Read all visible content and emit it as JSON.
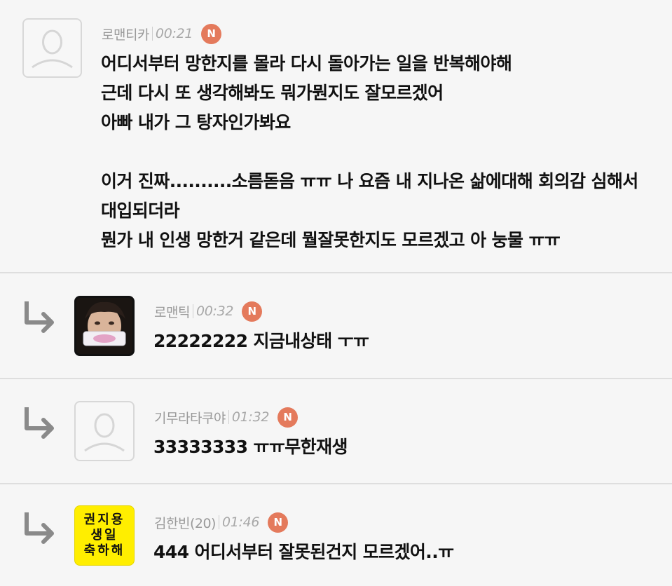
{
  "comments": [
    {
      "nickname": "로맨티카",
      "time": "00:21",
      "badge": "N",
      "avatar": "default-profile-icon",
      "lines": [
        "어디서부터 망한지를 몰라 다시 돌아가는 일을 반복해야해",
        "근데 다시 또 생각해봐도 뭐가뭔지도 잘모르겠어",
        "아빠 내가 그 탕자인가봐요",
        "",
        "이거 진짜..........소름돋음 ㅠㅠ 나 요즘 내 지나온 삶에대해 회의감 심해서",
        "대입되더라",
        "뭔가 내 인생 망한거 같은데 뭘잘못한지도 모르겠고 아 눙물 ㅠㅠ"
      ]
    },
    {
      "nickname": "로맨틱",
      "time": "00:32",
      "badge": "N",
      "avatar": "photo-avatar",
      "lines": [
        "22222222 지금내상태 ㅜㅠ"
      ]
    },
    {
      "nickname": "기무라타쿠야",
      "time": "01:32",
      "badge": "N",
      "avatar": "default-profile-icon",
      "lines": [
        "33333333 ㅠㅠ무한재생"
      ]
    },
    {
      "nickname": "김한빈(20)",
      "time": "01:46",
      "badge": "N",
      "avatar_lines": [
        "권지용",
        "생일",
        "축하해"
      ],
      "lines": [
        "444 어디서부터 잘못된건지 모르겠어..ㅠ"
      ]
    }
  ],
  "icons": {
    "reply": "reply-arrow-icon",
    "default_avatar": "default-profile-icon"
  },
  "colors": {
    "badge": "#e47a5c",
    "yellow_avatar": "#ffee00",
    "background": "#f6f6f6"
  }
}
